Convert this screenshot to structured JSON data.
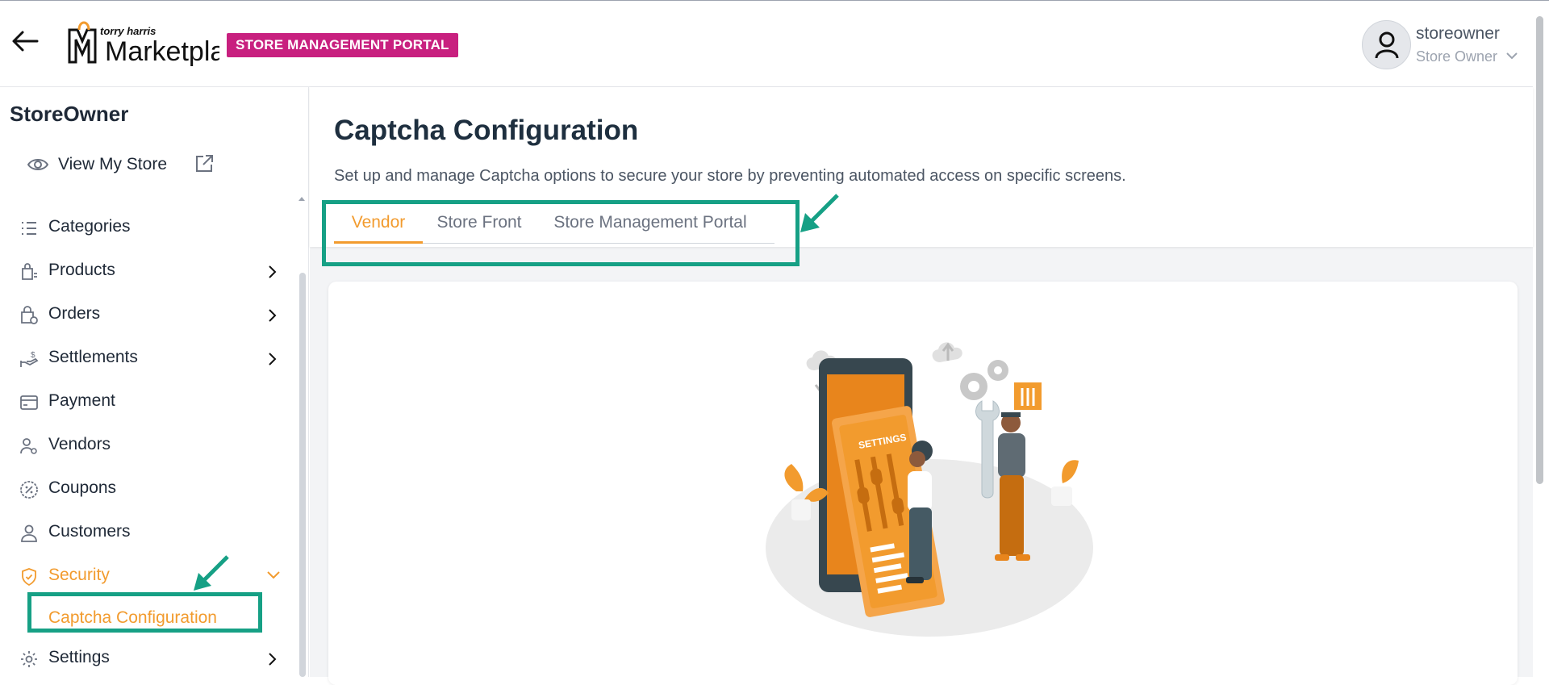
{
  "header": {
    "logo_small": "torry harris",
    "logo_main": "Marketplace",
    "portal_badge": "STORE MANAGEMENT PORTAL",
    "user": {
      "name": "storeowner",
      "role": "Store Owner"
    }
  },
  "sidebar": {
    "title": "StoreOwner",
    "view_store_label": "View My Store",
    "items": [
      {
        "label": "Categories",
        "icon": "list-icon",
        "has_children": false
      },
      {
        "label": "Products",
        "icon": "shopping-bag-icon",
        "has_children": true
      },
      {
        "label": "Orders",
        "icon": "order-bag-icon",
        "has_children": true
      },
      {
        "label": "Settlements",
        "icon": "hand-coin-icon",
        "has_children": true
      },
      {
        "label": "Payment",
        "icon": "card-icon",
        "has_children": false
      },
      {
        "label": "Vendors",
        "icon": "users-icon",
        "has_children": false
      },
      {
        "label": "Coupons",
        "icon": "percent-badge-icon",
        "has_children": false
      },
      {
        "label": "Customers",
        "icon": "user-icon",
        "has_children": false
      },
      {
        "label": "Security",
        "icon": "shield-icon",
        "has_children": true,
        "expanded": true,
        "active": true
      },
      {
        "label": "Settings",
        "icon": "gear-icon",
        "has_children": true
      }
    ],
    "security_sub": {
      "label": "Captcha Configuration",
      "active": true
    }
  },
  "main": {
    "title": "Captcha Configuration",
    "description": "Set up and manage Captcha options to secure your store by preventing automated access on specific screens.",
    "tabs": [
      {
        "label": "Vendor",
        "active": true
      },
      {
        "label": "Store Front",
        "active": false
      },
      {
        "label": "Store Management Portal",
        "active": false
      }
    ],
    "illustration_label": "SETTINGS"
  },
  "colors": {
    "accent": "#f29b2e",
    "badge": "#c8207f",
    "annotation": "#16a085",
    "title": "#1e2f3f"
  }
}
